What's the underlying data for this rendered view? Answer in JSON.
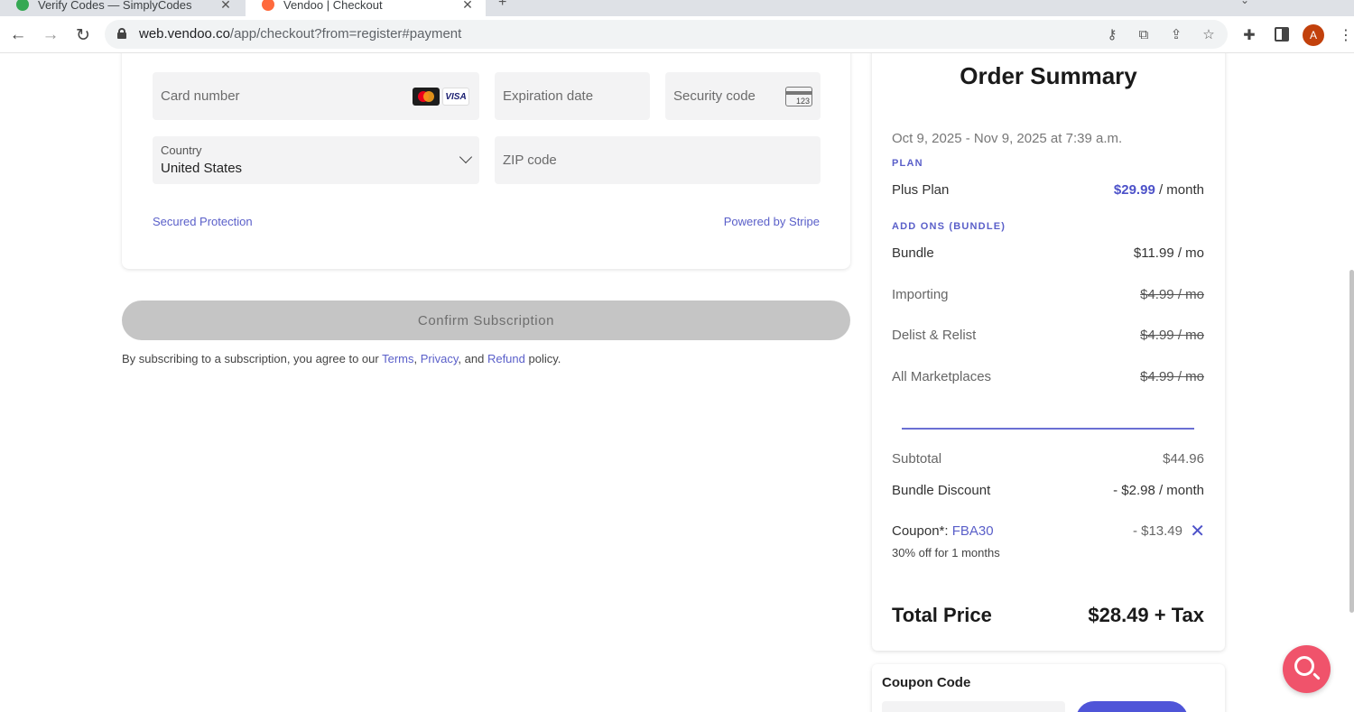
{
  "browser": {
    "tabs": [
      {
        "title": "Verify Codes — SimplyCodes",
        "active": false
      },
      {
        "title": "Vendoo | Checkout",
        "active": true
      }
    ],
    "new_tab": "+",
    "close_glyph": "✕",
    "url_host": "web.vendoo.co",
    "url_path": "/app/checkout?from=register#payment",
    "profile_initial": "A"
  },
  "payment": {
    "card_number_placeholder": "Card number",
    "visa_label": "VISA",
    "expiration_placeholder": "Expiration date",
    "security_placeholder": "Security code",
    "cvc_hint": "123",
    "country_label": "Country",
    "country_value": "United States",
    "zip_placeholder": "ZIP code",
    "secured_text": "Secured Protection",
    "powered_text": "Powered by Stripe"
  },
  "confirm": {
    "label": "Confirm Subscription"
  },
  "legal": {
    "prefix": "By subscribing to a subscription, you agree to our",
    "terms": "Terms",
    "comma": ",",
    "privacy": "Privacy",
    "and": ", and",
    "refund": "Refund",
    "suffix": "policy."
  },
  "summary": {
    "title": "Order Summary",
    "dates": "Oct 9, 2025 - Nov 9, 2025 at 7:39 a.m.",
    "plan_label": "PLAN",
    "plan_name": "Plus Plan",
    "plan_price": "$29.99",
    "plan_period": "/ month",
    "addons_label": "ADD ONS (BUNDLE)",
    "addons": [
      {
        "name": "Bundle",
        "price": "$11.99 / mo"
      },
      {
        "name": "Importing",
        "price": "$4.99 / mo"
      },
      {
        "name": "Delist & Relist",
        "price": "$4.99 / mo"
      },
      {
        "name": "All Marketplaces",
        "price": "$4.99 / mo"
      }
    ],
    "subtotal_label": "Subtotal",
    "subtotal_value": "$44.96",
    "discount_label": "Bundle Discount",
    "discount_value": "- $2.98 / month",
    "coupon_label": "Coupon*:",
    "coupon_code": "FBA30",
    "coupon_value": "- $13.49",
    "coupon_note": "30% off for 1 months",
    "remove_glyph": "✕",
    "total_label": "Total Price",
    "total_value": "$28.49 + Tax"
  },
  "coupon_box": {
    "title": "Coupon Code"
  },
  "colors": {
    "accent": "#5a5fc9",
    "button_disabled": "#c5c5c5",
    "help_fab": "#f0536b",
    "apply_button": "#4f55d8"
  }
}
